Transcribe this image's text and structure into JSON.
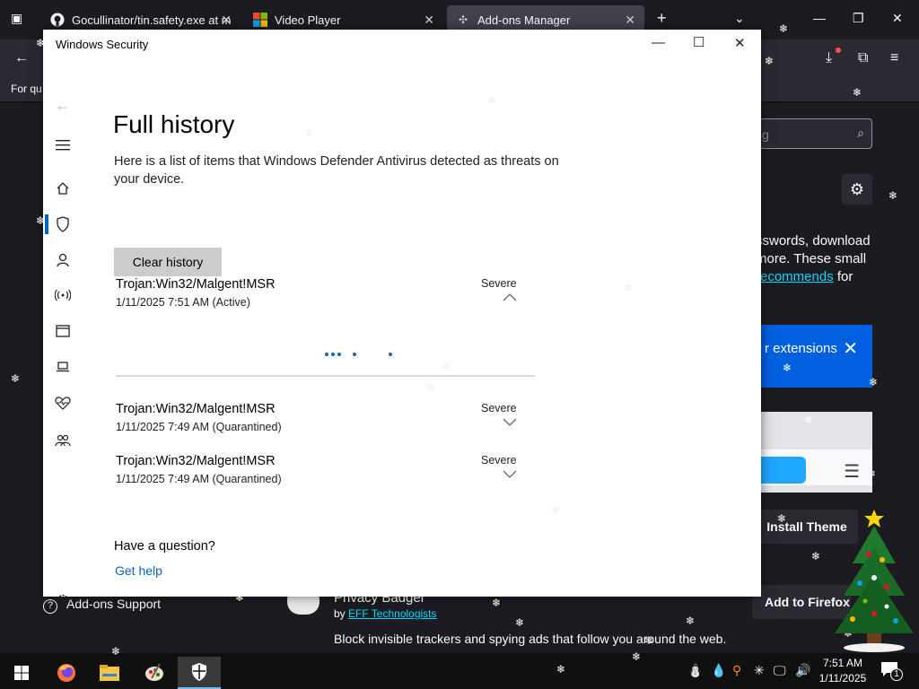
{
  "browser": {
    "tabs": [
      {
        "title": "Gocullinator/tin.safety.exe at m",
        "icon": "github-icon"
      },
      {
        "title": "Video Player",
        "icon": "microsoft-icon"
      },
      {
        "title": "Add-ons Manager",
        "icon": "puzzle-icon",
        "active": true
      }
    ],
    "bookmarks_text": "For qu"
  },
  "addons_page": {
    "search_placeholder_fragment": "g",
    "intro_lines": [
      "sswords, download",
      "more. These small"
    ],
    "intro_link": "recommends",
    "intro_after_link": " for",
    "banner_text": "r extensions",
    "install_theme_label": "Install Theme",
    "extension_name": "Privacy Badger",
    "extension_by_prefix": "by ",
    "extension_author": "EFF Technologists",
    "extension_description": "Block invisible trackers and spying ads that follow you around the web.",
    "add_button_label": "Add to Firefox",
    "support_label": "Add-ons Support"
  },
  "security_window": {
    "title": "Windows Security",
    "heading": "Full history",
    "description": "Here is a list of items that Windows Defender Antivirus detected as threats on your device.",
    "clear_button": "Clear history",
    "threats": [
      {
        "name": "Trojan:Win32/Malgent!MSR",
        "meta": "1/11/2025 7:51 AM (Active)",
        "severity": "Severe",
        "expanded": true
      },
      {
        "name": "Trojan:Win32/Malgent!MSR",
        "meta": "1/11/2025 7:49 AM (Quarantined)",
        "severity": "Severe",
        "expanded": false
      },
      {
        "name": "Trojan:Win32/Malgent!MSR",
        "meta": "1/11/2025 7:49 AM (Quarantined)",
        "severity": "Severe",
        "expanded": false
      }
    ],
    "question": "Have a question?",
    "help_link": "Get help",
    "accent": "#0067c0"
  },
  "taskbar": {
    "time": "7:51 AM",
    "date": "1/11/2025",
    "notification_count": "1"
  }
}
